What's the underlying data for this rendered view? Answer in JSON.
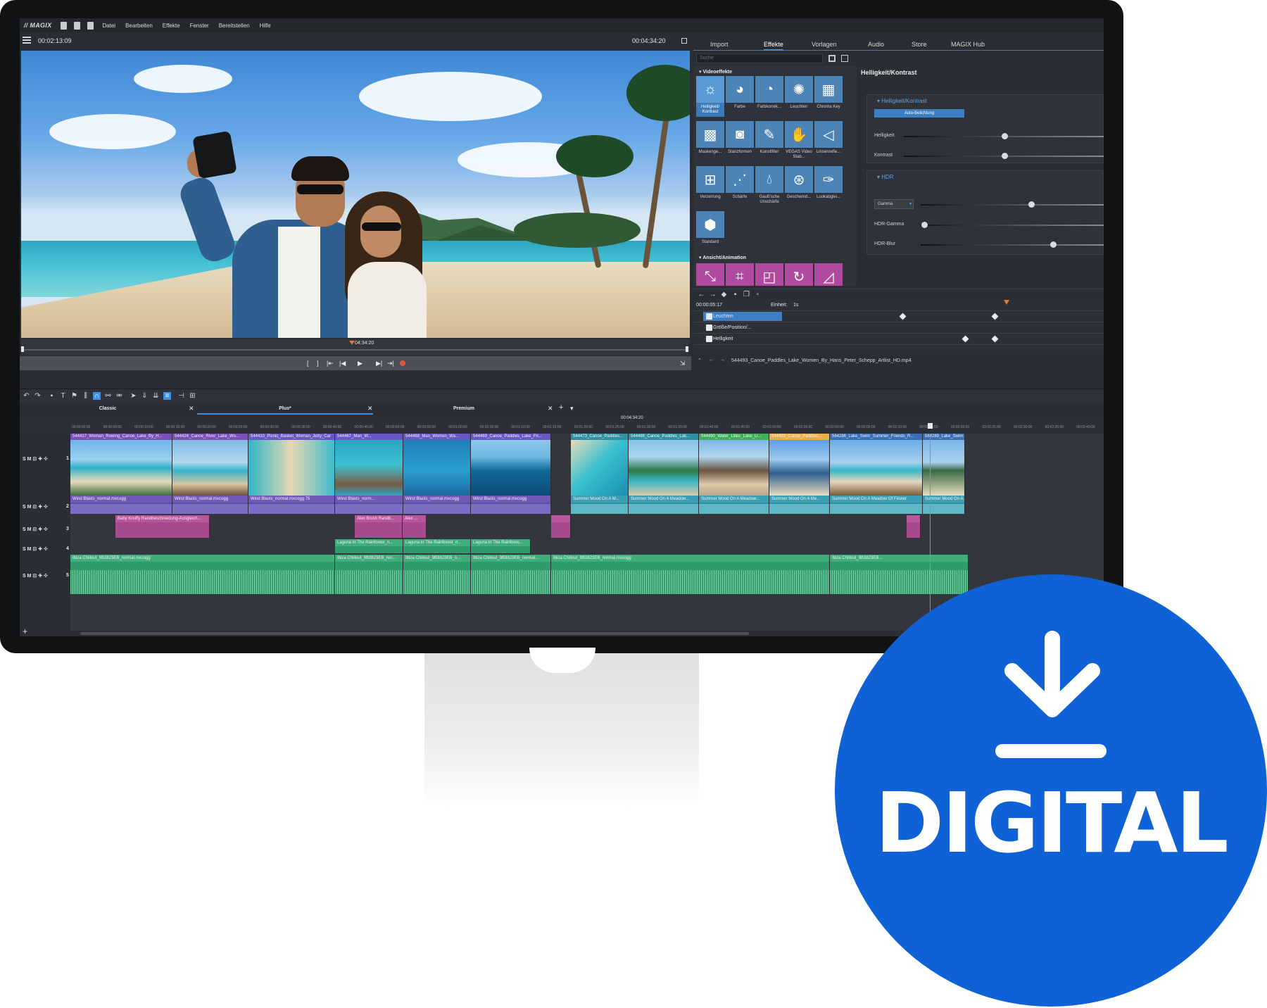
{
  "app": {
    "logo": "// MAGIX",
    "menu": [
      "Datei",
      "Bearbeiten",
      "Effekte",
      "Fenster",
      "Bereitstellen",
      "Hilfe"
    ]
  },
  "preview": {
    "timecode_left": "00:02:13:09",
    "timecode_right": "00:04:34:20",
    "scrub_timecode": "04:34:20"
  },
  "right_panel": {
    "tabs": [
      "Import",
      "Effekte",
      "Vorlagen",
      "Audio",
      "Store",
      "MAGIX Hub"
    ],
    "active_tab": "Effekte",
    "search_placeholder": "Suche",
    "section_video": "Videoeffekte",
    "section_anim": "Ansicht/Animation",
    "effects": [
      {
        "label": "Helligkeit/ Kontrast",
        "icon": "sun-icon"
      },
      {
        "label": "Farbe",
        "icon": "palette-icon"
      },
      {
        "label": "Farbkorrek...",
        "icon": "palette-icon"
      },
      {
        "label": "Leuchten",
        "icon": "glow-icon"
      },
      {
        "label": "Chroma Key",
        "icon": "chroma-icon"
      },
      {
        "label": "Maskenge...",
        "icon": "mask-icon"
      },
      {
        "label": "Stanzformen",
        "icon": "shape-icon"
      },
      {
        "label": "Kunstfilter",
        "icon": "art-icon"
      },
      {
        "label": "VEGAS Video Stab...",
        "icon": "hand-icon"
      },
      {
        "label": "Linsenrefle...",
        "icon": "lens-icon"
      },
      {
        "label": "Verzerrung",
        "icon": "grid-icon"
      },
      {
        "label": "Schärfe",
        "icon": "sharpen-icon"
      },
      {
        "label": "Gauß'sche Unschärfe",
        "icon": "drop-icon"
      },
      {
        "label": "Geschwind...",
        "icon": "speed-icon"
      },
      {
        "label": "Lookabglei...",
        "icon": "dropper-icon"
      },
      {
        "label": "Standard",
        "icon": "hexagon-icon"
      }
    ],
    "props_title": "Helligkeit/Kontrast",
    "box1_title": "Helligkeit/Kontrast",
    "auto_button": "Auto-Belichtung",
    "brightness_label": "Helligkeit",
    "contrast_label": "Kontrast",
    "box2_title": "HDR",
    "gamma_select": "Gamma",
    "hdr_gamma_label": "HDR-Gamma",
    "hdr_blur_label": "HDR-Blur",
    "sliders": {
      "brightness": 0.5,
      "contrast": 0.5,
      "gamma": 0.6,
      "hdr_gamma": 0.02,
      "hdr_blur": 0.72
    }
  },
  "keyframes": {
    "timecode": "00:00:05:17",
    "unit_label": "Einheit:",
    "unit_value": "1s",
    "rows": [
      "Leuchten",
      "Größe/Position/...",
      "Helligkeit"
    ],
    "file": "544493_Canoe_Paddles_Lake_Women_By_Hans_Peter_Schepp_Artlist_HD.mp4"
  },
  "timeline": {
    "tabs": [
      "Classic",
      "Plus*",
      "Premium"
    ],
    "ruler_center": "00:04:34:20",
    "ruler_ticks": [
      "00:00:00:00",
      "00:00:05:00",
      "00:00:10:00",
      "00:00:15:00",
      "00:00:20:00",
      "00:00:25:00",
      "00:00:30:00",
      "00:00:35:00",
      "00:00:40:00",
      "00:00:45:00",
      "00:00:50:00",
      "00:00:55:00",
      "00:01:00:00",
      "00:01:05:00",
      "00:01:10:00",
      "00:01:15:00",
      "00:01:20:00",
      "00:01:25:00",
      "00:01:30:00",
      "00:01:35:00",
      "00:01:40:00",
      "00:01:45:00",
      "00:01:50:00",
      "00:01:55:00",
      "00:02:00:00",
      "00:02:05:00",
      "00:02:10:00",
      "00:02:15:00",
      "00:02:20:00",
      "00:02:25:00",
      "00:02:30:00",
      "00:02:35:00",
      "00:02:40:00"
    ],
    "track_numbers": [
      "1",
      "2",
      "3",
      "4",
      "5"
    ],
    "track_ctrl": "S M",
    "video_clips": [
      "544417_Woman_Rowing_Canoe_Lake_By_H...",
      "544424_Canoe_River_Lake_Wo...",
      "544410_Picnic_Basket_Woman_Jetty_Car",
      "544467_Man_W...",
      "544468_Man_Women_Wa...",
      "544469_Canoe_Paddles_Lake_Fri...",
      "544473_Canoe_Paddles...",
      "544486_Canoe_Paddles_Lak...",
      "544490_Water_Lilies_Lake_Li...",
      "544493_Canoe_Paddles...",
      "564286_Lake_Swim_Summer_Friends_R...",
      "564289_Lake_Swim..."
    ],
    "audio2_clips": [
      "Wind Blasts_normal.mxcogg",
      "Wind Blasts_normal.mxcogg",
      "Wind Blasts_normal.mxcogg 75",
      "Wind Blasts_norm...",
      "Wind Blasts_normal.mxcogg",
      "Wind Blasts_normal.mxcogg",
      "Summer Mood On A M...",
      "Summer Mood On A Meadow...",
      "Summer Mood On A Meadow...",
      "Summer Mood On A Me...",
      "Summer Mood On A Meadow Of Flower",
      "Summer Mood On A..."
    ],
    "track3_clips": [
      "Baby Knuffy  Randbeschneidung-Ausgleich...",
      "Alex Brush  Randb...",
      "Alex ..."
    ],
    "track4_clips": [
      "Laguna In The Rainforest_n...",
      "Laguna In The Rainforest_n...",
      "Laguna In The Rainfores..."
    ],
    "track5_clips": [
      "Ibiza Chillout_9B3823EB_normal.mxcogg",
      "Ibiza Chillout_9B3823EB_nor...",
      "Ibiza Chillout_9B3823EB_n...",
      "Ibiza Chillout_9B3823EB_normal...",
      "Ibiza Chillout_9B3823EB_normal.mxcogg",
      "Ibiza Chillout_9B3823EB..."
    ]
  },
  "badge": {
    "text": "DIGITAL",
    "color": "#0f62d6"
  }
}
